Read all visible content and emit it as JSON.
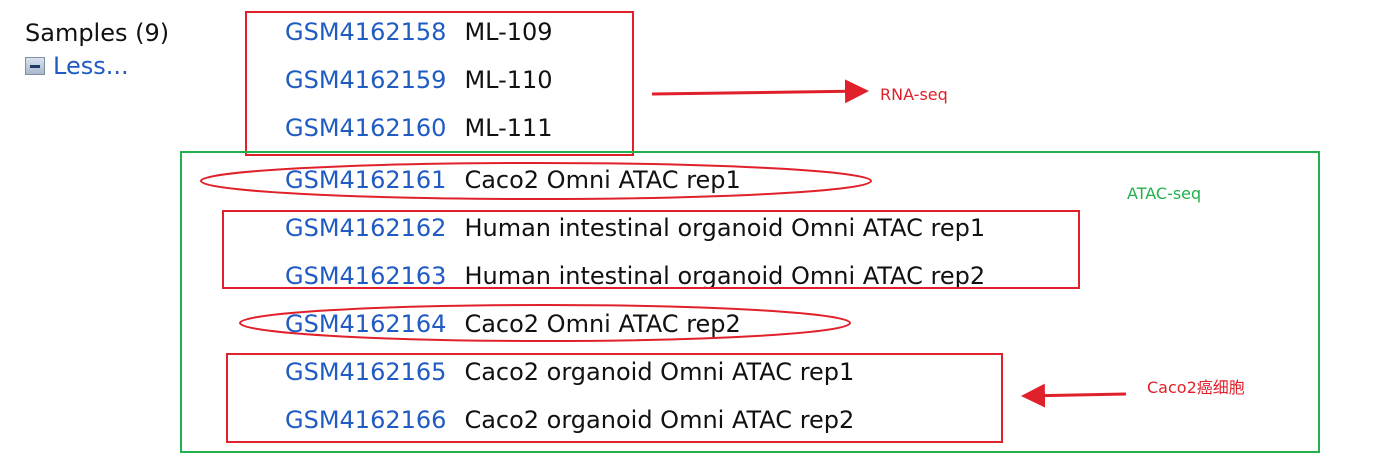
{
  "header": {
    "samples_label": "Samples (9)",
    "less_label": "Less..."
  },
  "samples": [
    {
      "accession": "GSM4162158",
      "title": "ML-109"
    },
    {
      "accession": "GSM4162159",
      "title": "ML-110"
    },
    {
      "accession": "GSM4162160",
      "title": "ML-111"
    },
    {
      "accession": "GSM4162161",
      "title": "Caco2 Omni ATAC rep1"
    },
    {
      "accession": "GSM4162162",
      "title": "Human intestinal organoid Omni ATAC rep1"
    },
    {
      "accession": "GSM4162163",
      "title": "Human intestinal organoid Omni ATAC rep2"
    },
    {
      "accession": "GSM4162164",
      "title": "Caco2 Omni ATAC rep2"
    },
    {
      "accession": "GSM4162165",
      "title": "Caco2 organoid Omni ATAC rep1"
    },
    {
      "accession": "GSM4162166",
      "title": "Caco2 organoid Omni ATAC rep2"
    }
  ],
  "annotations": {
    "rna_seq_label": "RNA-seq",
    "atac_seq_label": "ATAC-seq",
    "caco2_label": "Caco2癌细胞"
  },
  "colors": {
    "link": "#1f5bc2",
    "annotation_red": "#e0202a",
    "annotation_green": "#22b14c"
  }
}
